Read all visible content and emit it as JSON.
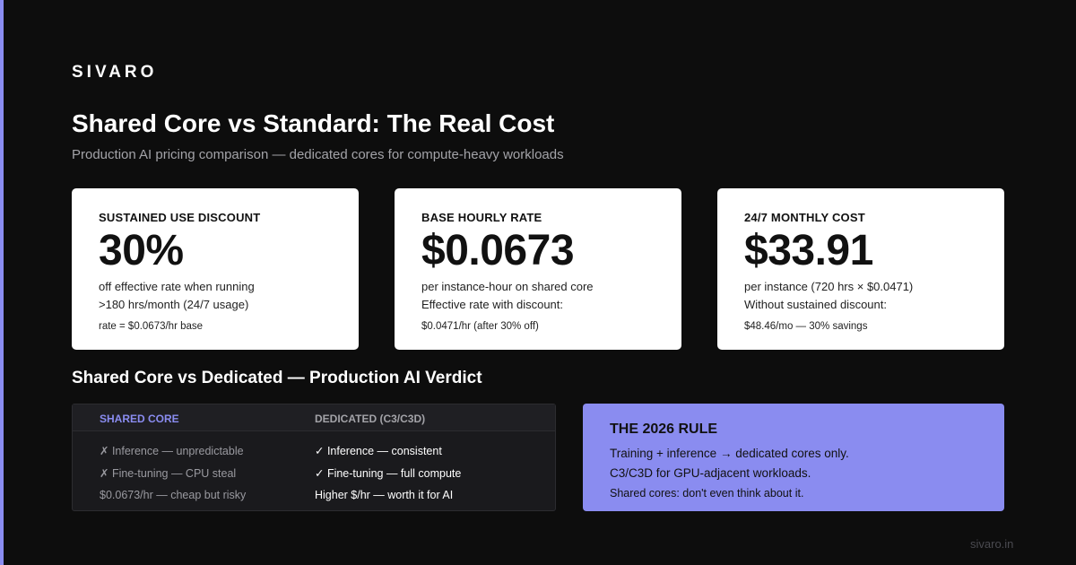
{
  "brand": "SIVARO",
  "title": "Shared Core vs Standard: The Real Cost",
  "subtitle": "Production AI pricing comparison — dedicated cores for compute-heavy workloads",
  "cards": [
    {
      "label": "SUSTAINED USE DISCOUNT",
      "value": "30%",
      "desc1": "off effective rate when running",
      "desc2": ">180 hrs/month (24/7 usage)",
      "foot": "rate = $0.0673/hr base"
    },
    {
      "label": "BASE HOURLY RATE",
      "value": "$0.0673",
      "desc1": "per instance-hour on shared core",
      "desc2": "Effective rate with discount:",
      "foot": "$0.0471/hr (after 30% off)"
    },
    {
      "label": "24/7 MONTHLY COST",
      "value": "$33.91",
      "desc1": "per instance (720 hrs × $0.0471)",
      "desc2": "Without sustained discount:",
      "foot": "$48.46/mo — 30% savings"
    }
  ],
  "verdict": {
    "title": "Shared Core vs Dedicated — Production AI Verdict",
    "header_shared": "SHARED CORE",
    "header_dedicated": "DEDICATED (C3/C3D)",
    "rows": [
      {
        "shared": "✗ Inference — unpredictable",
        "dedicated": "✓ Inference — consistent"
      },
      {
        "shared": "✗ Fine-tuning — CPU steal",
        "dedicated": "✓ Fine-tuning — full compute"
      },
      {
        "shared": "$0.0673/hr — cheap but risky",
        "dedicated": "Higher $/hr — worth it for AI"
      }
    ]
  },
  "rule": {
    "title": "THE 2026 RULE",
    "line1": "Training + inference → dedicated cores only.",
    "line2": "C3/C3D for GPU-adjacent workloads.",
    "line3": "Shared cores: don't even think about it."
  },
  "footer": "sivaro.in",
  "colors": {
    "accent": "#8a8cf0",
    "background": "#0d0d0d",
    "card": "#ffffff"
  }
}
